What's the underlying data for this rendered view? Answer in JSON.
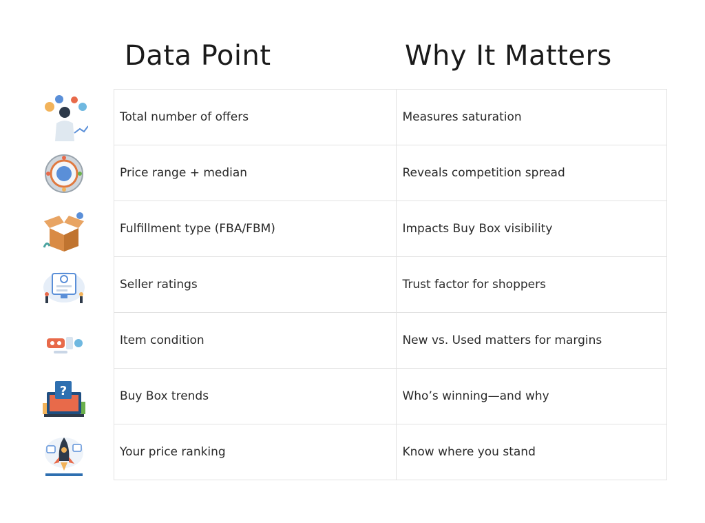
{
  "headings": {
    "data_point": "Data Point",
    "why_it_matters": "Why It Matters"
  },
  "rows": [
    {
      "icon": "analyst-person-icon",
      "data_point": "Total number of offers",
      "why": "Measures saturation"
    },
    {
      "icon": "price-wheel-icon",
      "data_point": "Price range + median",
      "why": "Reveals competition spread"
    },
    {
      "icon": "open-box-icon",
      "data_point": "Fulfillment type (FBA/FBM)",
      "why": "Impacts Buy Box visibility"
    },
    {
      "icon": "rating-monitor-icon",
      "data_point": "Seller ratings",
      "why": "Trust factor for shoppers"
    },
    {
      "icon": "item-condition-icon",
      "data_point": "Item condition",
      "why": "New vs. Used matters for margins"
    },
    {
      "icon": "buy-box-question-icon",
      "data_point": "Buy Box trends",
      "why": "Who’s winning—and why"
    },
    {
      "icon": "rocket-ranking-icon",
      "data_point": "Your price ranking",
      "why": "Know where you stand"
    }
  ]
}
